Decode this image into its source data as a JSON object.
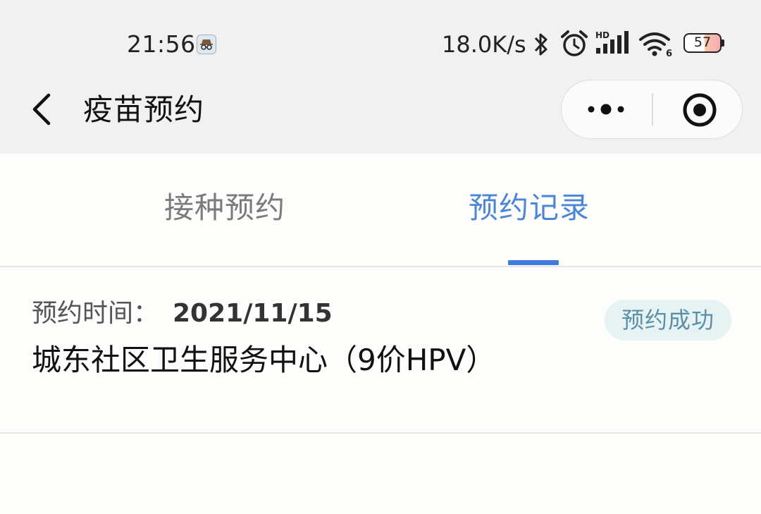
{
  "status_bar": {
    "time": "21:56",
    "app_icon": "incognito-icon",
    "network_speed": "18.0K/s",
    "icons": [
      "bluetooth-icon",
      "alarm-icon",
      "hd-signal-icon",
      "wifi-icon"
    ],
    "wifi_badge": "6",
    "signal_badge": "HD",
    "battery_level": "57"
  },
  "nav": {
    "title": "疫苗预约",
    "back_icon": "chevron-left-icon",
    "more_icon": "more-dots-icon",
    "close_icon": "target-close-icon"
  },
  "tabs": [
    {
      "label": "接种预约",
      "active": false
    },
    {
      "label": "预约记录",
      "active": true
    }
  ],
  "records": [
    {
      "time_label": "预约时间：",
      "time_value": "2021/11/15",
      "status": "预约成功",
      "site": "城东社区卫生服务中心（9价HPV）"
    }
  ],
  "colors": {
    "accent": "#3f7ce0",
    "tab_active_text": "#4d86d6",
    "tab_inactive_text": "#7b7b7b",
    "status_badge_bg": "#e6f3f2",
    "status_badge_text": "#5b8fa8",
    "topbar_bg": "#f1f1f1",
    "page_bg": "#fdfdfb"
  }
}
